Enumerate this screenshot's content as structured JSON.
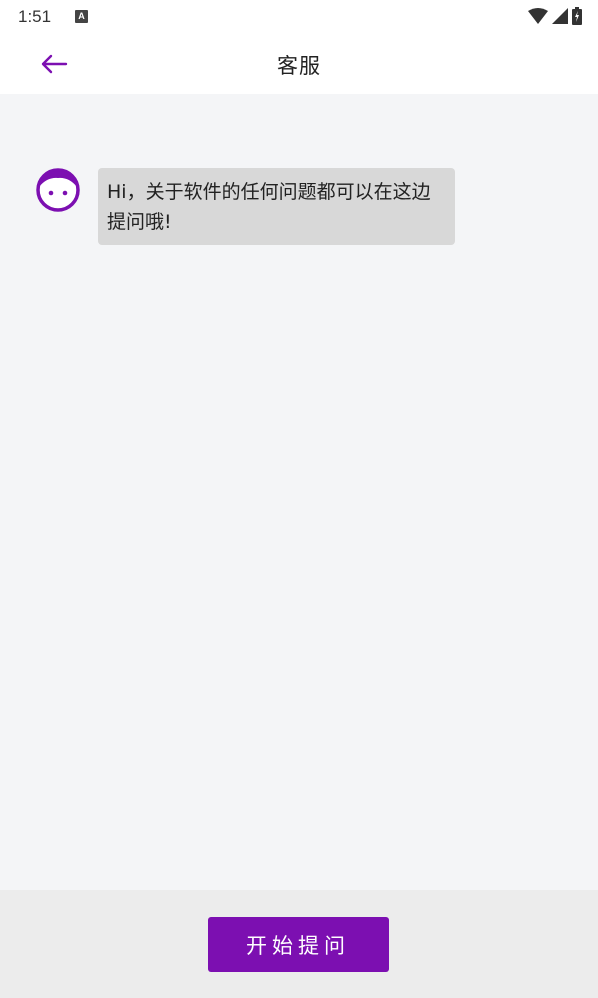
{
  "status_bar": {
    "time": "1:51",
    "notification_letter": "A"
  },
  "header": {
    "title": "客服"
  },
  "chat": {
    "messages": [
      {
        "sender": "service",
        "text": "Hi，关于软件的任何问题都可以在这边提问哦!"
      }
    ]
  },
  "footer": {
    "start_button_label": "开始提问"
  },
  "colors": {
    "accent": "#7c0fb1",
    "chat_background": "#f4f5f7",
    "bubble_background": "#d8d8d8",
    "footer_background": "#ececec"
  },
  "icons": {
    "back": "arrow-left-icon",
    "avatar": "face-icon",
    "wifi": "wifi-icon",
    "signal": "signal-icon",
    "battery": "battery-icon"
  }
}
